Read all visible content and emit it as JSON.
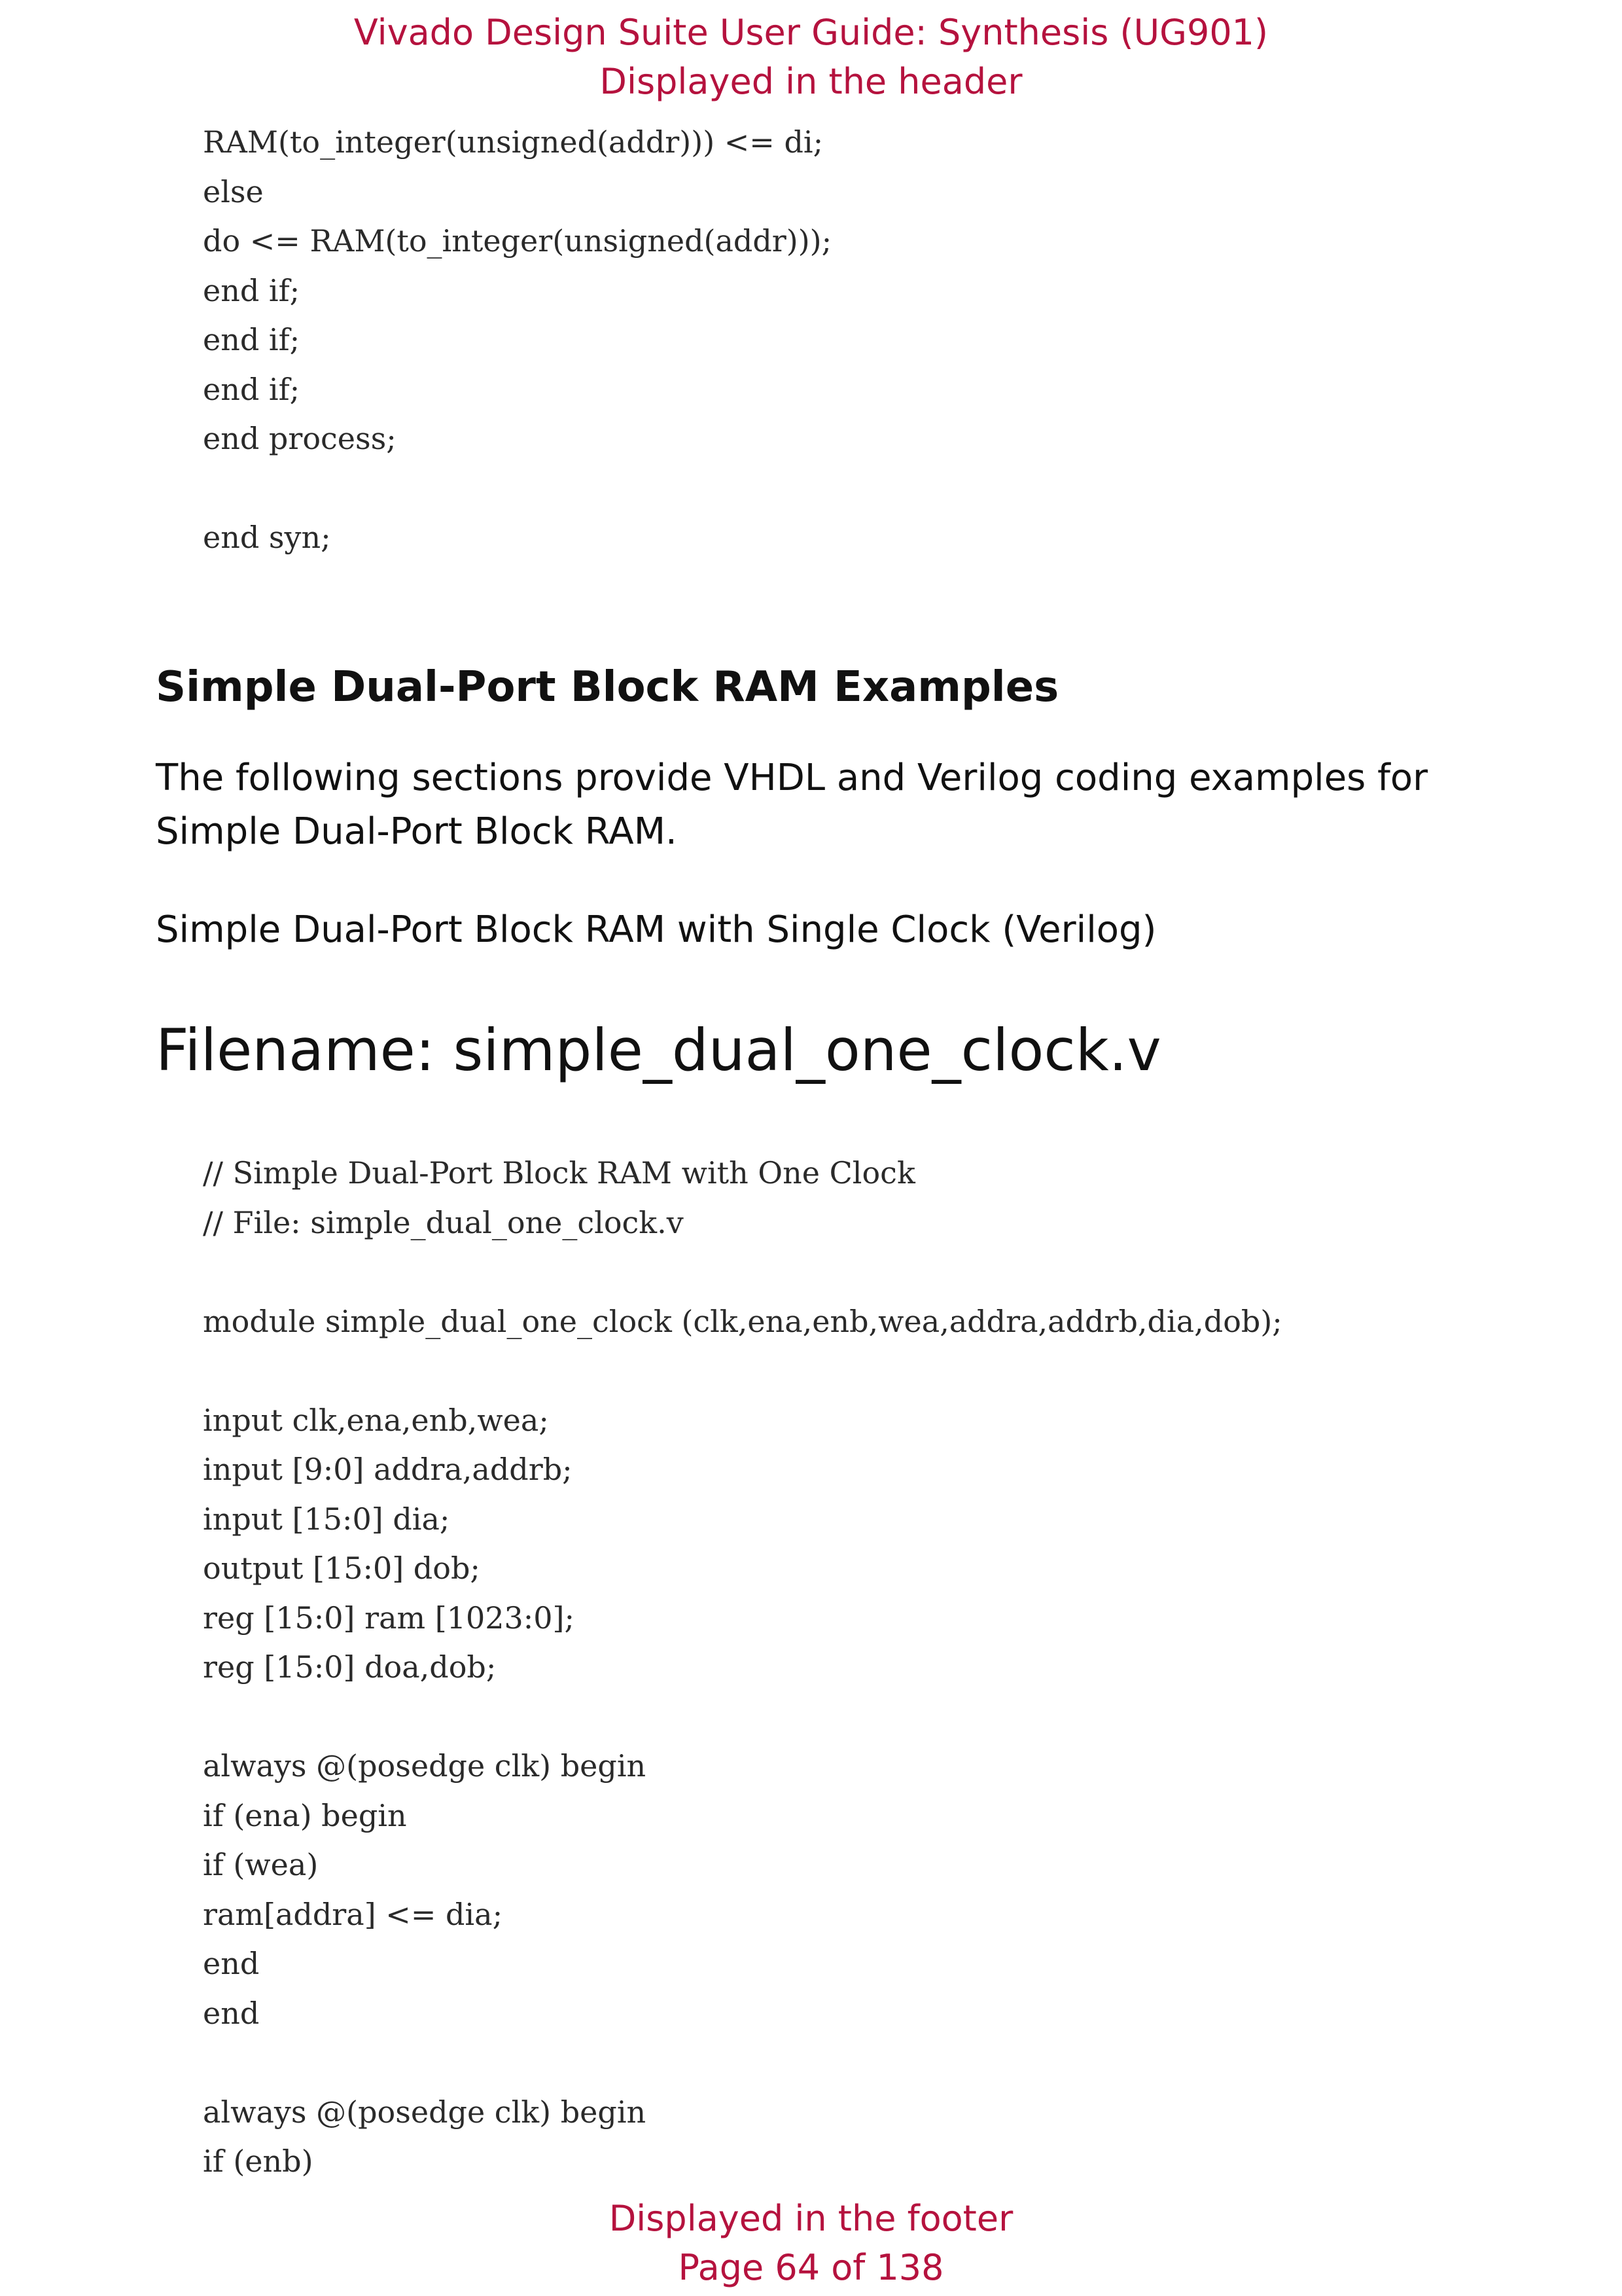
{
  "header": {
    "title": "Vivado Design Suite User Guide: Synthesis (UG901)",
    "subtitle": "Displayed in the header"
  },
  "code_block_1": [
    "RAM(to_integer(unsigned(addr))) <= di;",
    "else",
    "do <= RAM(to_integer(unsigned(addr)));",
    "end if;",
    "end if;",
    "end if;",
    "end process;",
    "",
    "end syn;"
  ],
  "section": {
    "title": "Simple Dual-Port Block RAM Examples",
    "intro": "The following sections provide VHDL and Verilog coding examples for Simple Dual-Port Block RAM.",
    "subsection_title": "Simple Dual-Port Block RAM with Single Clock (Verilog)",
    "filename_heading": "Filename: simple_dual_one_clock.v"
  },
  "code_block_2": [
    "// Simple Dual-Port Block RAM with One Clock",
    "// File: simple_dual_one_clock.v",
    "",
    "module simple_dual_one_clock (clk,ena,enb,wea,addra,addrb,dia,dob);",
    "",
    "input clk,ena,enb,wea;",
    "input [9:0] addra,addrb;",
    "input [15:0] dia;",
    "output [15:0] dob;",
    "reg [15:0] ram [1023:0];",
    "reg [15:0] doa,dob;",
    "",
    "always @(posedge clk) begin",
    "if (ena) begin",
    "if (wea)",
    "ram[addra] <= dia;",
    "end",
    "end",
    "",
    "always @(posedge clk) begin",
    "if (enb)"
  ],
  "footer": {
    "label": "Displayed in the footer",
    "page": "Page 64 of 138"
  },
  "colors": {
    "header_footer": "#b5123e",
    "body_text": "#111111",
    "code_text": "#2a2a2a"
  }
}
